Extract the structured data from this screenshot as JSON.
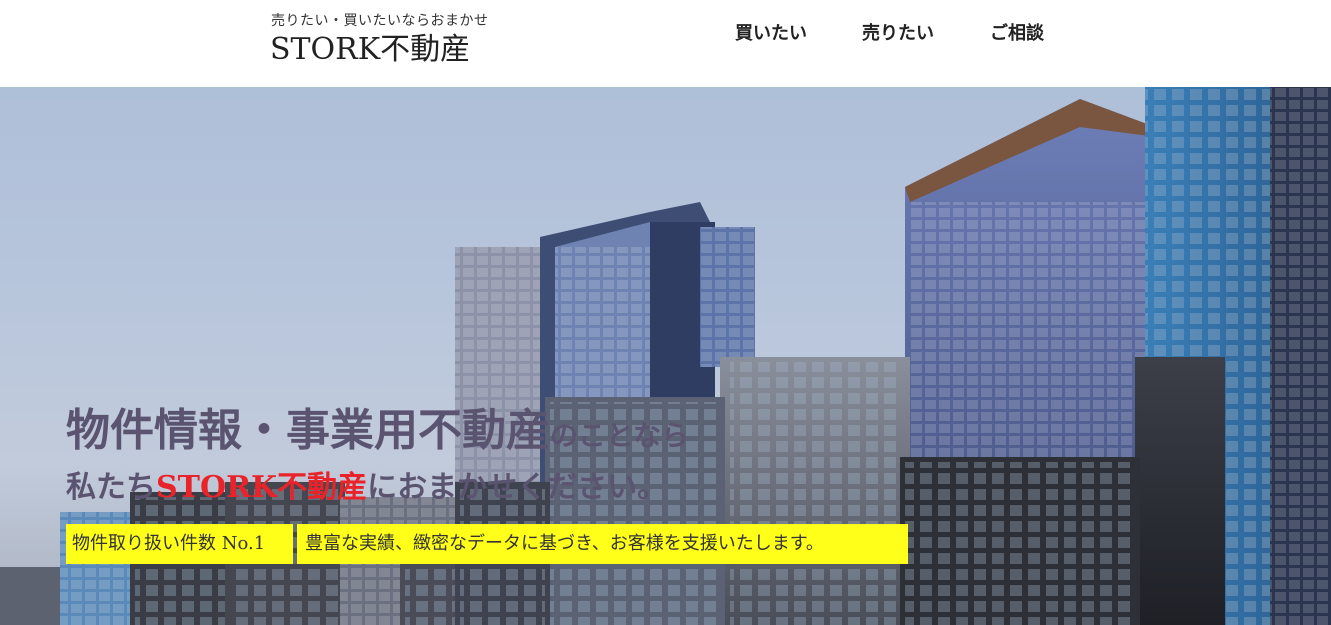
{
  "header": {
    "tagline": "売りたい・買いたいならおまかせ",
    "logo": "STORK不動産",
    "nav": [
      {
        "label": "買いたい"
      },
      {
        "label": "売りたい"
      },
      {
        "label": "ご相談"
      }
    ]
  },
  "hero": {
    "headline_main": "物件情報・事業用不動産",
    "headline_suffix": "のことなら",
    "subline_prefix": "私たち",
    "subline_brand": "STORK不動産",
    "subline_suffix": "におまかせください。",
    "badges": [
      {
        "text": "物件取り扱い件数 No.1"
      },
      {
        "text": "豊富な実績、緻密なデータに基づき、お客様を支援いたします。"
      }
    ],
    "background_image": "city-skyscrapers-photo"
  },
  "colors": {
    "accent_red": "#e8242a",
    "badge_yellow": "#ffff1a",
    "headline_text": "#5b5470"
  }
}
